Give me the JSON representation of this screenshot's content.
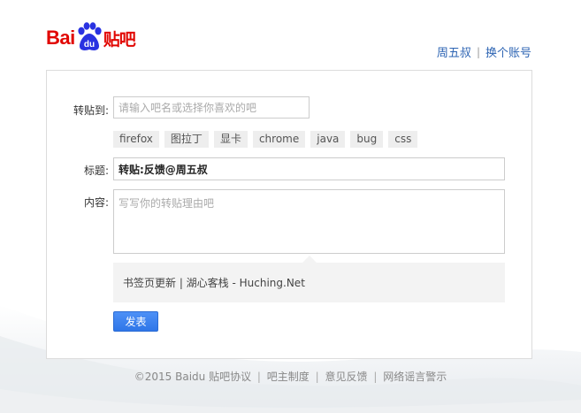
{
  "logo": {
    "bai": "Bai",
    "du": "du",
    "tieba": "贴吧"
  },
  "userbar": {
    "username": "周五叔",
    "switch_account": "换个账号"
  },
  "form": {
    "target_label": "转贴到:",
    "target_placeholder": "请输入吧名或选择你喜欢的吧",
    "tags": [
      "firefox",
      "图拉丁",
      "显卡",
      "chrome",
      "java",
      "bug",
      "css"
    ],
    "title_label": "标题:",
    "title_value": "转贴:反馈@周五叔",
    "content_label": "内容:",
    "content_placeholder": "写写你的转贴理由吧",
    "quote_text": "书签页更新 | 湖心客栈 - Huching.Net",
    "submit_label": "发表"
  },
  "footer": {
    "copyright": "©2015 Baidu",
    "links": [
      "贴吧协议",
      "吧主制度",
      "意见反馈",
      "网络谣言警示"
    ]
  },
  "colors": {
    "brand_red": "#e10601",
    "link_blue": "#2d64b3",
    "paw_blue": "#2932e1",
    "button_blue": "#3a7ff0"
  }
}
